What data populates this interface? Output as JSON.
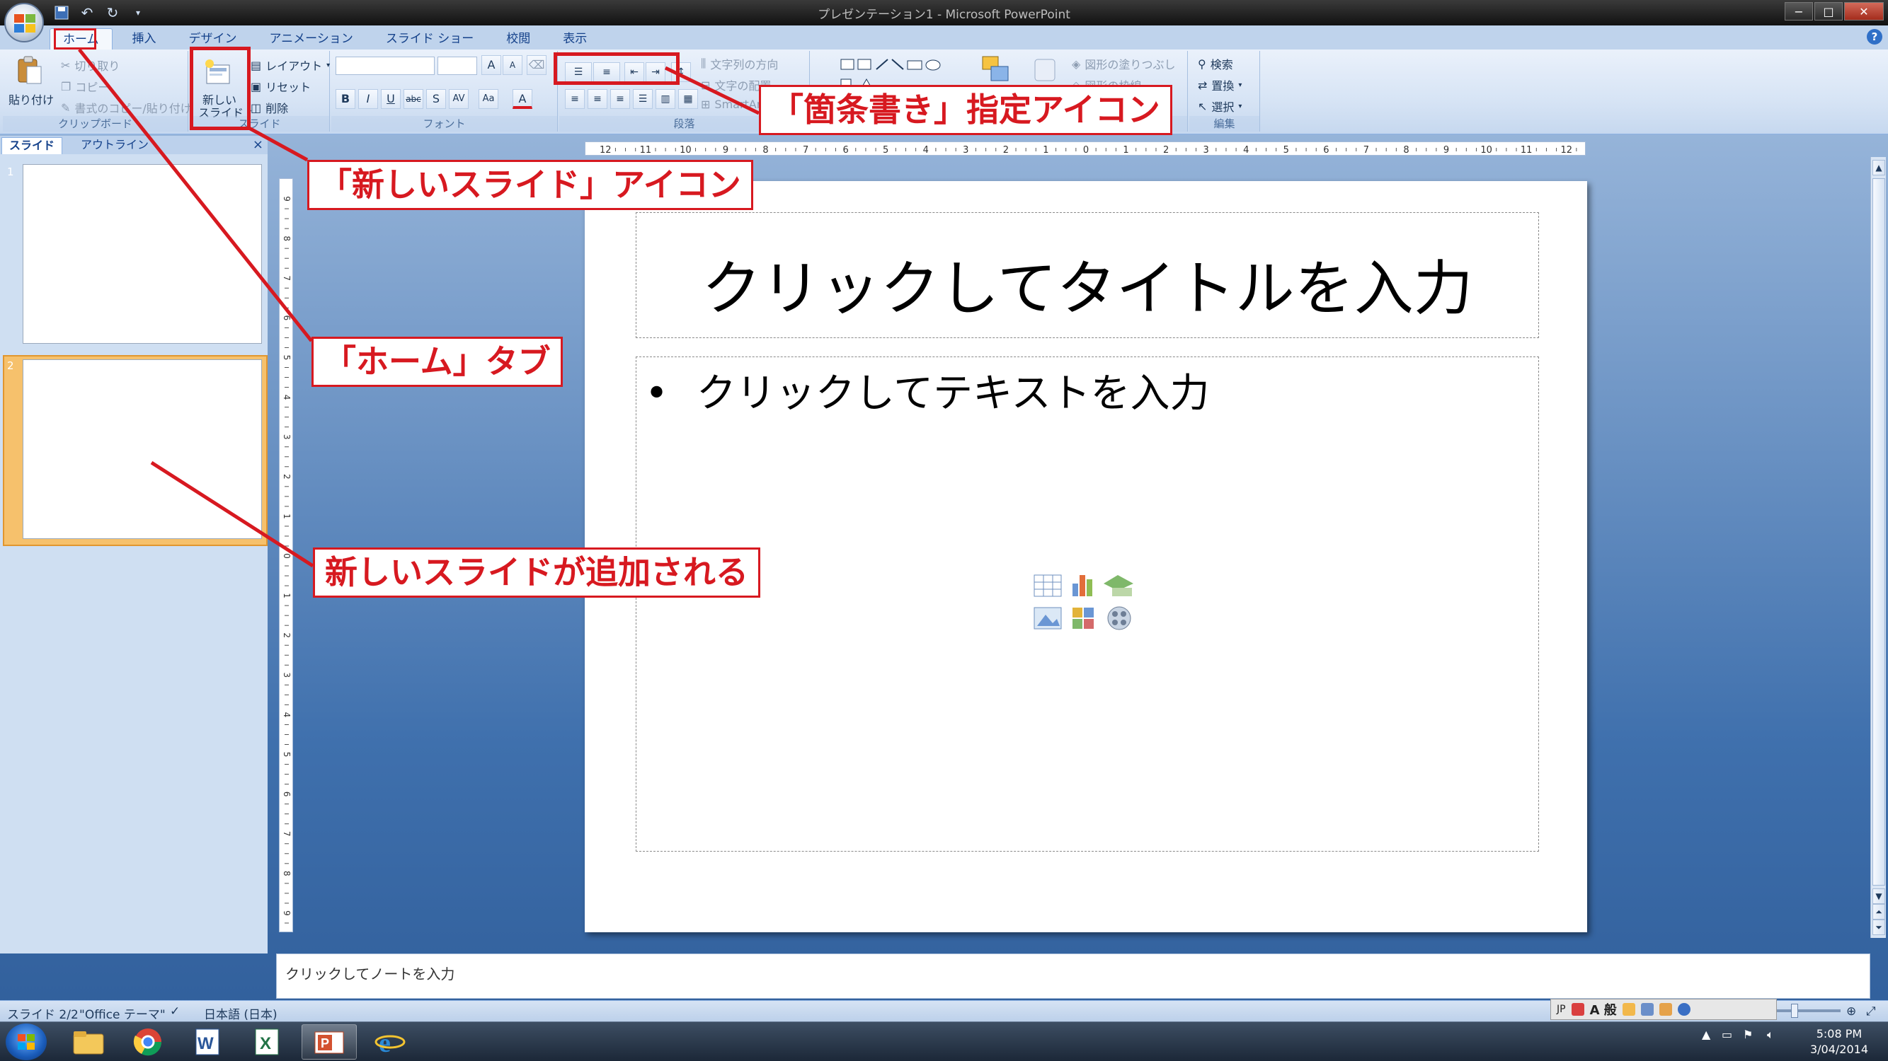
{
  "window": {
    "title": "プレゼンテーション1 - Microsoft PowerPoint",
    "controls": [
      "−",
      "□",
      "✕"
    ]
  },
  "quick_access": [
    "save-icon",
    "undo-icon",
    "redo-icon",
    "customize-icon"
  ],
  "tabs": [
    "ホーム",
    "挿入",
    "デザイン",
    "アニメーション",
    "スライド ショー",
    "校閲",
    "表示"
  ],
  "ribbon": {
    "clipboard": {
      "paste": "貼り付け",
      "cut": "切り取り",
      "copy": "コピー",
      "format_painter": "書式のコピー/貼り付け",
      "label": "クリップボード"
    },
    "slides": {
      "new_slide_line1": "新しい",
      "new_slide_line2": "スライド",
      "layout": "レイアウト",
      "reset": "リセット",
      "delete": "削除",
      "label": "スライド"
    },
    "font": {
      "label": "フォント",
      "bold": "B",
      "italic": "I",
      "underline": "U",
      "strike": "abc",
      "shadow": "S",
      "spacing": "AV",
      "case": "Aa",
      "color": "A",
      "grow": "A",
      "shrink": "A"
    },
    "paragraph": {
      "label": "段落",
      "text_direction": "文字列の方向",
      "align_text": "文字の配置",
      "smartart": "SmartArt"
    },
    "drawing": {
      "shape_fill": "図形の塗りつぶし",
      "shape_outline": "図形の枠線"
    },
    "editing": {
      "find": "検索",
      "replace": "置換",
      "select": "選択",
      "label": "編集"
    }
  },
  "left_pane": {
    "tabs": [
      "スライド",
      "アウトライン"
    ],
    "close": "×",
    "slides": [
      {
        "number": "1",
        "selected": false
      },
      {
        "number": "2",
        "selected": true
      }
    ]
  },
  "ruler": {
    "horizontal": [
      "12",
      "11",
      "10",
      "9",
      "8",
      "7",
      "6",
      "5",
      "4",
      "3",
      "2",
      "1",
      "0",
      "1",
      "2",
      "3",
      "4",
      "5",
      "6",
      "7",
      "8",
      "9",
      "10",
      "11",
      "12"
    ],
    "vertical": [
      "9",
      "8",
      "7",
      "6",
      "5",
      "4",
      "3",
      "2",
      "1",
      "0",
      "1",
      "2",
      "3",
      "4",
      "5",
      "6",
      "7",
      "8",
      "9"
    ]
  },
  "slide": {
    "title_placeholder": "クリックしてタイトルを入力",
    "bullet": "•",
    "body_placeholder": "クリックしてテキストを入力"
  },
  "notes": {
    "placeholder": "クリックしてノートを入力"
  },
  "statusbar": {
    "slide_count": "スライド 2/2",
    "theme": "\"Office テーマ\"",
    "language": "日本語 (日本)",
    "ime_mode": "JP",
    "ime_input": "A 般"
  },
  "annotations": {
    "bullets_icon": "「箇条書き」指定アイコン",
    "new_slide_icon": "「新しいスライド」アイコン",
    "home_tab": "「ホーム」タブ",
    "slide_added": "新しいスライドが追加される"
  },
  "taskbar": {
    "apps": [
      "explorer-icon",
      "chrome-icon",
      "word-icon",
      "excel-icon",
      "powerpoint-icon",
      "ie-icon"
    ],
    "clock_time": "5:08 PM",
    "clock_date": "3/04/2014"
  },
  "colors": {
    "annotation_red": "#d71920",
    "selection_orange": "#f6c16c",
    "ribbon_blue": "#d7e4f5",
    "workspace_blue": "#3f70ad"
  }
}
